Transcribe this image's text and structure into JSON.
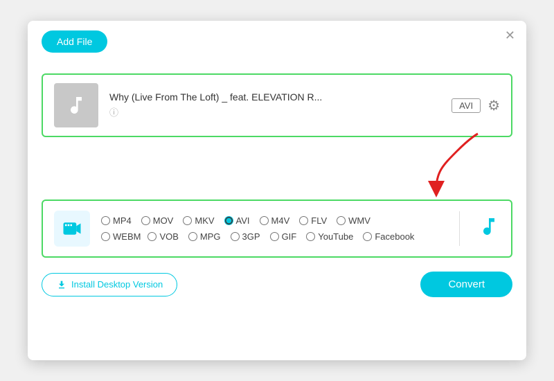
{
  "dialog": {
    "close_label": "✕"
  },
  "toolbar": {
    "add_file_label": "Add File"
  },
  "file_item": {
    "title": "Why (Live From The Loft) _ feat. ELEVATION R...",
    "format_badge": "AVI",
    "info_icon": "ⓘ"
  },
  "format_section": {
    "formats_row1": [
      "MP4",
      "MOV",
      "MKV",
      "AVI",
      "M4V",
      "FLV",
      "WMV"
    ],
    "formats_row2": [
      "WEBM",
      "VOB",
      "MPG",
      "3GP",
      "GIF",
      "YouTube",
      "Facebook"
    ],
    "selected_format": "AVI"
  },
  "footer": {
    "install_label": "Install Desktop Version",
    "convert_label": "Convert"
  }
}
